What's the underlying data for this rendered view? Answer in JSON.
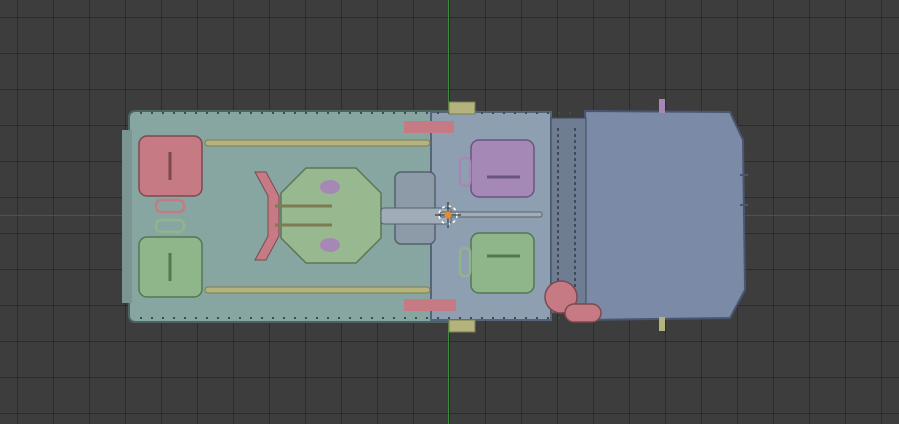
{
  "viewport": {
    "view": "top-orthographic",
    "grid": true,
    "x_axis_color": "#8a3838",
    "y_axis_color": "#3e8a3e"
  },
  "model": {
    "object": "armored-vehicle-with-anti-aircraft-gun",
    "colors": {
      "rear_deck": "#87a6a1",
      "mid_deck": "#8f9fb2",
      "cab": "#7b8aa6",
      "red_hatch": "#c67a84",
      "green_hatch": "#8fb58b",
      "purple_hatch": "#a588b6",
      "platform": "#98b88f",
      "rails": "#b4b37e",
      "gun": "#8d9ba8",
      "origin": "#e88a2e"
    }
  }
}
